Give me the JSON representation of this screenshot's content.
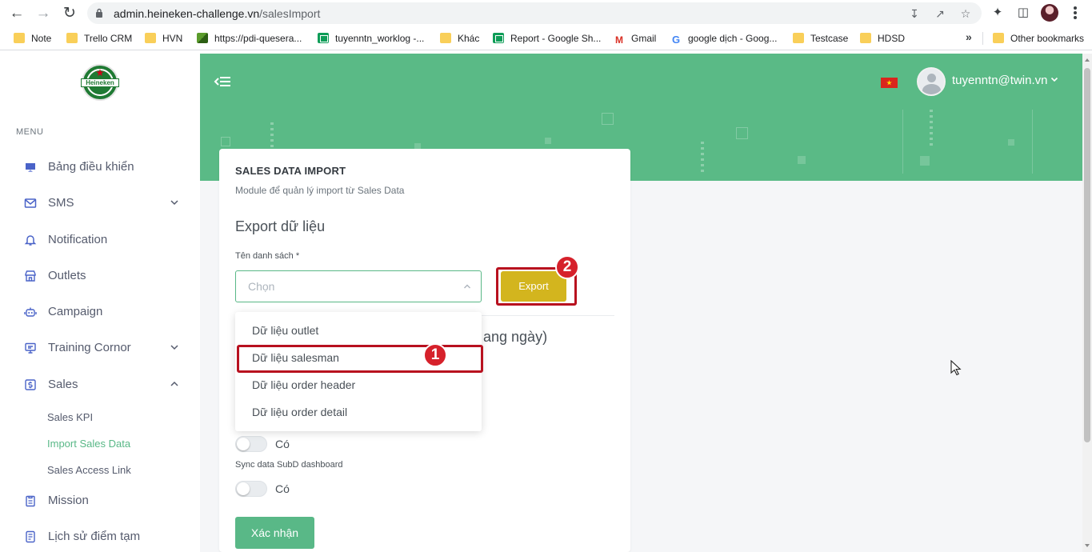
{
  "browser": {
    "url_host": "admin.heineken-challenge.vn",
    "url_path": "/salesImport",
    "bookmarks": [
      {
        "label": "Note",
        "icon": "folder-icon"
      },
      {
        "label": "Trello CRM",
        "icon": "folder-icon"
      },
      {
        "label": "HVN",
        "icon": "folder-icon"
      },
      {
        "label": "https://pdi-quesera...",
        "icon": "pdi-icon"
      },
      {
        "label": "tuyenntn_worklog -...",
        "icon": "sheets-icon"
      },
      {
        "label": "Khác",
        "icon": "folder-icon"
      },
      {
        "label": "Report - Google Sh...",
        "icon": "sheets-icon"
      },
      {
        "label": "Gmail",
        "icon": "gmail-icon"
      },
      {
        "label": "google dịch - Goog...",
        "icon": "google-icon"
      },
      {
        "label": "Testcase",
        "icon": "folder-icon"
      },
      {
        "label": "HDSD",
        "icon": "folder-icon"
      }
    ],
    "more_label": "»",
    "other_bookmarks": "Other bookmarks"
  },
  "logo_text": "Heineken",
  "sidebar": {
    "menu_title": "MENU",
    "items": [
      {
        "label": "Bảng điều khiển"
      },
      {
        "label": "SMS"
      },
      {
        "label": "Notification"
      },
      {
        "label": "Outlets"
      },
      {
        "label": "Campaign"
      },
      {
        "label": "Training Cornor"
      },
      {
        "label": "Sales"
      },
      {
        "label": "Mission"
      },
      {
        "label": "Lịch sử điểm tạm"
      }
    ],
    "sales_sub": [
      {
        "label": "Sales KPI"
      },
      {
        "label": "Import Sales Data"
      },
      {
        "label": "Sales Access Link"
      }
    ]
  },
  "header": {
    "user": "tuyenntn@twin.vn"
  },
  "card": {
    "title": "SALES DATA IMPORT",
    "subtitle": "Module để quản lý import từ Sales Data",
    "section_title": "Export dữ liệu",
    "field_label": "Tên danh sách *",
    "select_placeholder": "Chọn",
    "export_label": "Export",
    "hidden_title_fragment": "ang ngày)",
    "toggle1_text": "Có",
    "sync_label": "Sync data SubD dashboard",
    "toggle2_text": "Có",
    "confirm_label": "Xác nhận"
  },
  "dropdown": {
    "options": [
      {
        "label": "Dữ liệu outlet"
      },
      {
        "label": "Dữ liệu salesman"
      },
      {
        "label": "Dữ liệu order header"
      },
      {
        "label": "Dữ liệu order detail"
      }
    ]
  },
  "annotations": {
    "step1": "1",
    "step2": "2"
  },
  "colors": {
    "brand_green": "#5aba86",
    "export_yellow": "#d3b51e",
    "annotation_red": "#b8111f"
  }
}
